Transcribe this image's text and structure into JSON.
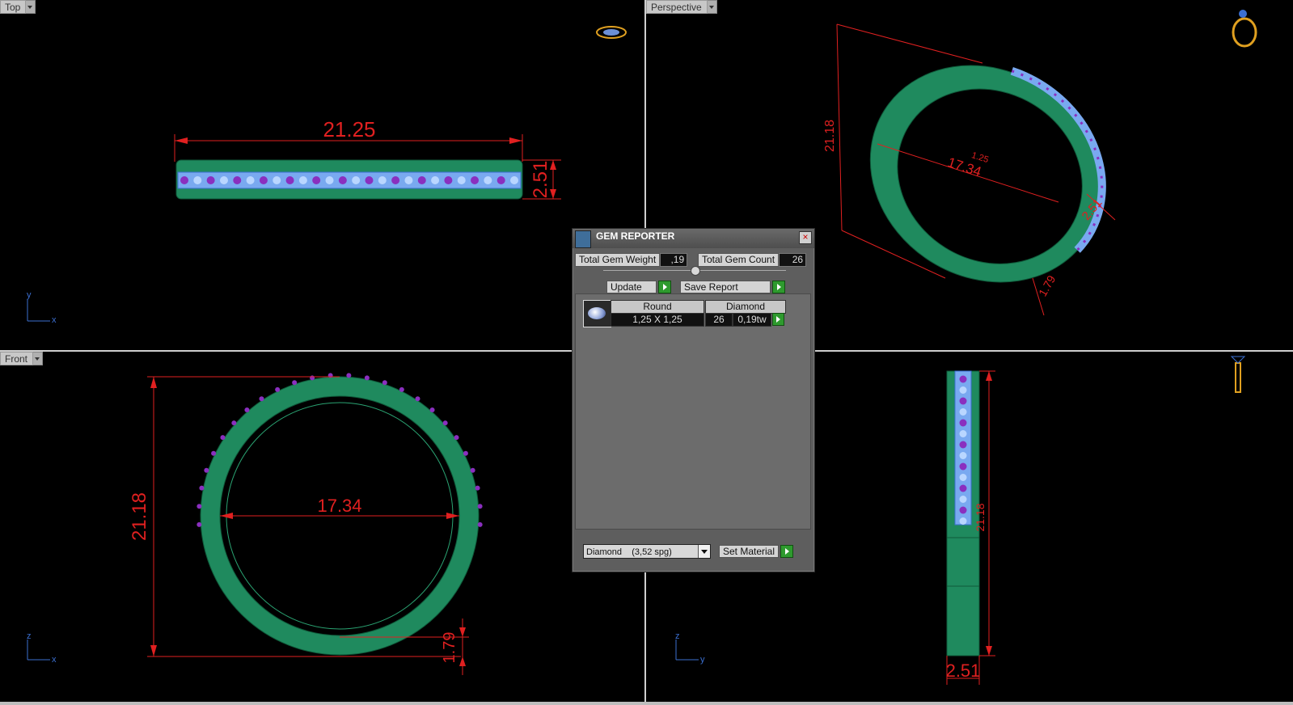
{
  "viewports": {
    "top": {
      "label": "Top",
      "dim_width": "21.25",
      "dim_height": "2.51",
      "axis_v": "y",
      "axis_h": "x"
    },
    "perspective": {
      "label": "Perspective",
      "dim_height": "21.18",
      "dim_inner": "17.34",
      "dim_depth": "2.51",
      "dim_thick": "1.79",
      "dim_center": "1.25"
    },
    "front": {
      "label": "Front",
      "dim_outer": "21.18",
      "dim_inner": "17.34",
      "dim_thick": "1.79",
      "axis_v": "z",
      "axis_h": "x"
    },
    "right": {
      "dim_bottom": "2.51",
      "dim_side": "21.18",
      "axis_v": "z",
      "axis_h": "y"
    }
  },
  "gem_reporter": {
    "title": "GEM REPORTER",
    "total_weight_label": "Total Gem Weight",
    "total_weight_value": ",19",
    "total_count_label": "Total Gem Count",
    "total_count_value": "26",
    "update_label": "Update",
    "save_report_label": "Save Report",
    "gems": [
      {
        "cut_header": "Round",
        "size": "1,25 X 1,25",
        "material_header": "Diamond",
        "count": "26",
        "weight": "0,19tw"
      }
    ],
    "material_select": "Diamond    (3,52 spg)",
    "set_material_label": "Set Material"
  },
  "colors": {
    "ring": "#1f8a5e",
    "gem_light": "#7fb3ff",
    "gem_setting": "#8a2fbf",
    "dimension": "#e02020"
  },
  "icons": [
    "ring-top-icon",
    "ring-perspective-icon",
    "ring-side-icon",
    "dropdown-arrow-icon",
    "close-icon",
    "play-arrow-icon"
  ]
}
